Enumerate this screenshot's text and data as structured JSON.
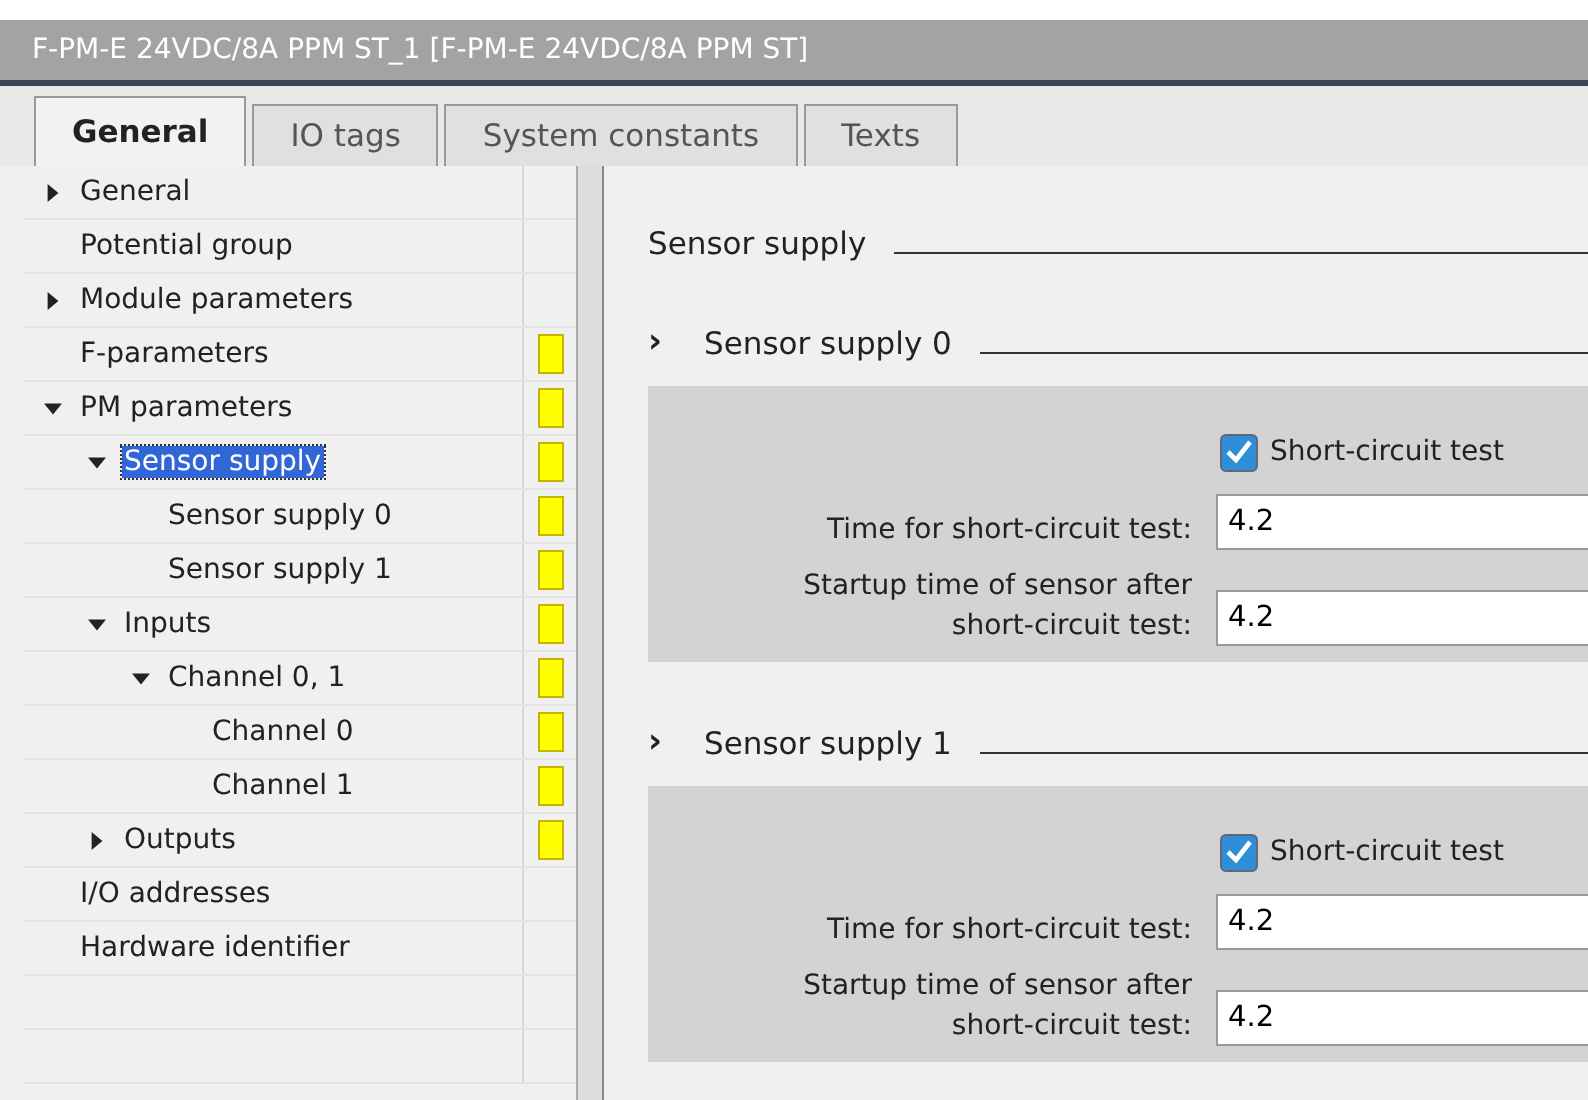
{
  "window": {
    "title": "F-PM-E 24VDC/8A PPM ST_1 [F-PM-E 24VDC/8A PPM ST]"
  },
  "tabs": [
    {
      "label": "General",
      "selected": true
    },
    {
      "label": "IO tags",
      "selected": false
    },
    {
      "label": "System constants",
      "selected": false
    },
    {
      "label": "Texts",
      "selected": false
    }
  ],
  "tree": [
    {
      "label": "General",
      "expanded": false,
      "selected": false,
      "flagged": false
    },
    {
      "label": "Potential group",
      "selected": false,
      "flagged": false
    },
    {
      "label": "Module parameters",
      "expanded": false,
      "selected": false,
      "flagged": false
    },
    {
      "label": "F-parameters",
      "selected": false,
      "flagged": true
    },
    {
      "label": "PM parameters",
      "expanded": true,
      "selected": false,
      "flagged": true,
      "children": [
        {
          "label": "Sensor supply",
          "expanded": true,
          "selected": true,
          "flagged": true,
          "children": [
            {
              "label": "Sensor supply 0",
              "selected": false,
              "flagged": true
            },
            {
              "label": "Sensor supply 1",
              "selected": false,
              "flagged": true
            }
          ]
        },
        {
          "label": "Inputs",
          "expanded": true,
          "selected": false,
          "flagged": true,
          "children": [
            {
              "label": "Channel 0, 1",
              "expanded": true,
              "selected": false,
              "flagged": true,
              "children": [
                {
                  "label": "Channel 0",
                  "selected": false,
                  "flagged": true
                },
                {
                  "label": "Channel 1",
                  "selected": false,
                  "flagged": true
                }
              ]
            }
          ]
        },
        {
          "label": "Outputs",
          "expanded": false,
          "selected": false,
          "flagged": true
        }
      ]
    },
    {
      "label": "I/O addresses",
      "selected": false,
      "flagged": false
    },
    {
      "label": "Hardware identifier",
      "selected": false,
      "flagged": false
    }
  ],
  "content": {
    "heading": "Sensor supply",
    "sections": [
      {
        "title": "Sensor supply 0",
        "expand_glyph": "›",
        "checkbox": {
          "label": "Short-circuit test",
          "checked": true
        },
        "fields": [
          {
            "label": "Time for short-circuit test:",
            "value": "4.2"
          },
          {
            "label": "Startup time of sensor after short-circuit test:",
            "value": "4.2"
          }
        ]
      },
      {
        "title": "Sensor supply 1",
        "expand_glyph": "›",
        "checkbox": {
          "label": "Short-circuit test",
          "checked": true
        },
        "fields": [
          {
            "label": "Time for short-circuit test:",
            "value": "4.2"
          },
          {
            "label": "Startup time of sensor after short-circuit test:",
            "value": "4.2"
          }
        ]
      }
    ]
  }
}
